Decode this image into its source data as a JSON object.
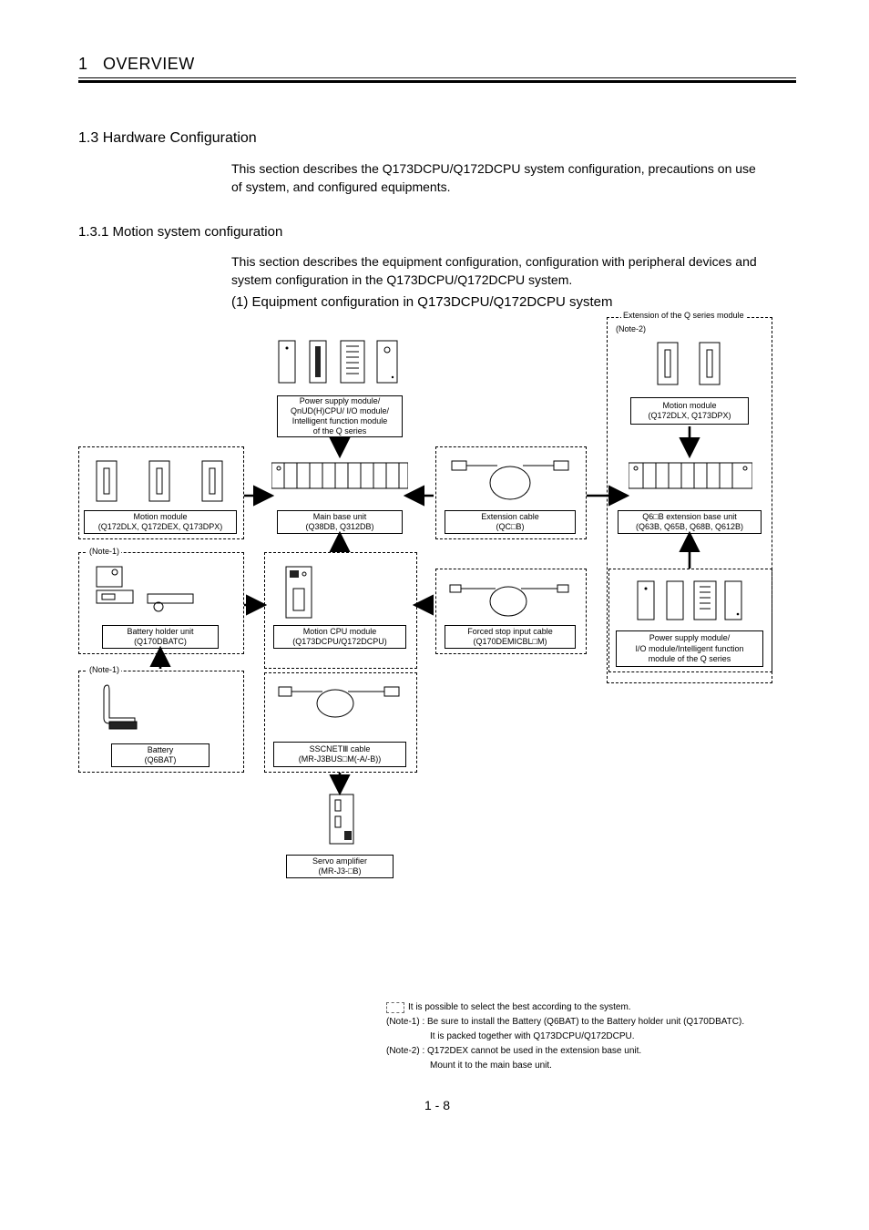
{
  "chapter": {
    "num": "1",
    "title": "OVERVIEW"
  },
  "section13": {
    "title": "1.3 Hardware Configuration",
    "body": "This section describes the Q173DCPU/Q172DCPU system configuration, precautions on use of system, and configured equipments."
  },
  "section131": {
    "title": "1.3.1 Motion system configuration",
    "body": "This section describes the equipment configuration, configuration with peripheral devices and system configuration in the Q173DCPU/Q172DCPU system."
  },
  "equipTitle": "(1)   Equipment configuration in Q173DCPU/Q172DCPU system",
  "diagram": {
    "extGroupLabel": "Extension of the Q series module",
    "note1": "(Note-1)",
    "note2": "(Note-2)",
    "caps": {
      "psu_cpu": "Power supply module/\nQnUD(H)CPU/ I/O module/\nIntelligent function module\nof the Q series",
      "motion_mod_ext": "Motion module\n(Q172DLX, Q173DPX)",
      "motion_mod": "Motion module\n(Q172DLX, Q172DEX, Q173DPX)",
      "main_base": "Main base unit\n(Q38DB, Q312DB)",
      "ext_cable": "Extension cable\n(QC□B)",
      "ext_base": "Q6□B  extension base unit\n(Q63B, Q65B, Q68B, Q612B)",
      "batt_holder": "Battery holder unit\n(Q170DBATC)",
      "motion_cpu": "Motion CPU module\n(Q173DCPU/Q172DCPU)",
      "forced_stop": "Forced stop input cable\n(Q170DEMICBL□M)",
      "psu_ext": "Power supply module/\nI/O module/Intelligent function\nmodule of the Q series",
      "battery": "Battery\n(Q6BAT)",
      "sscnet": "SSCNETⅢ cable\n(MR-J3BUS□M(-A/-B))",
      "servo": "Servo amplifier\n(MR-J3-□B)"
    }
  },
  "legend": {
    "select": "It is possible to select the best according to the system.",
    "n1a": "(Note-1) : Be sure to install the Battery (Q6BAT) to the Battery holder unit (Q170DBATC).",
    "n1b": "It is packed together with Q173DCPU/Q172DCPU.",
    "n2a": "(Note-2) : Q172DEX cannot be used in the extension base unit.",
    "n2b": "Mount it to the main base unit."
  },
  "pageNum": "1 - 8"
}
